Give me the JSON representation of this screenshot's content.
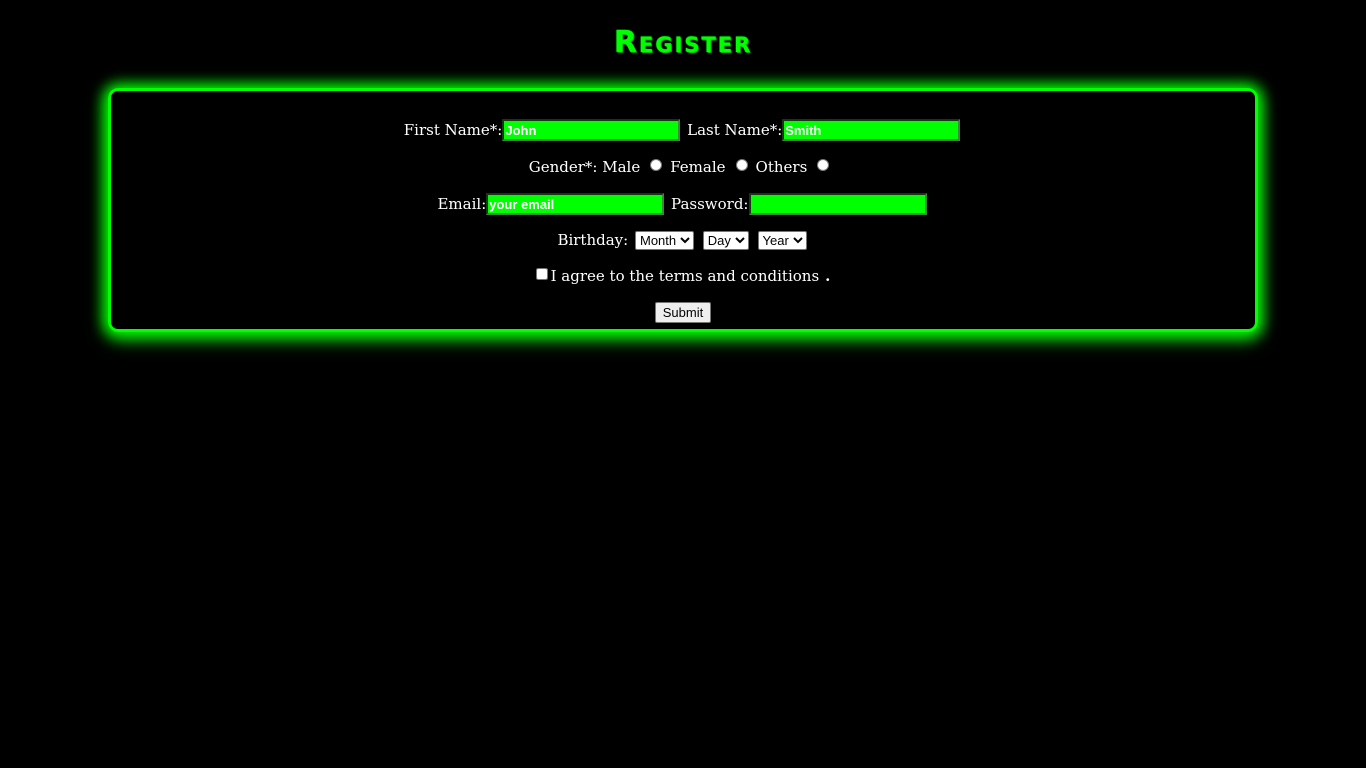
{
  "title": "Register",
  "colors": {
    "accent": "#00ff00",
    "background": "#000000",
    "text": "#ffffff"
  },
  "form": {
    "first_name": {
      "label": "First Name*:",
      "value": "John"
    },
    "last_name": {
      "label": "Last Name*:",
      "value": "Smith"
    },
    "gender": {
      "label": "Gender*:",
      "options": [
        "Male",
        "Female",
        "Others"
      ]
    },
    "email": {
      "label": "Email:",
      "placeholder": "your email",
      "value": ""
    },
    "password": {
      "label": "Password:",
      "value": ""
    },
    "birthday": {
      "label": "Birthday:",
      "month": "Month",
      "day": "Day",
      "year": "Year"
    },
    "terms": {
      "label": "I agree to the terms and conditions",
      "suffix": "."
    },
    "submit_label": "Submit"
  }
}
